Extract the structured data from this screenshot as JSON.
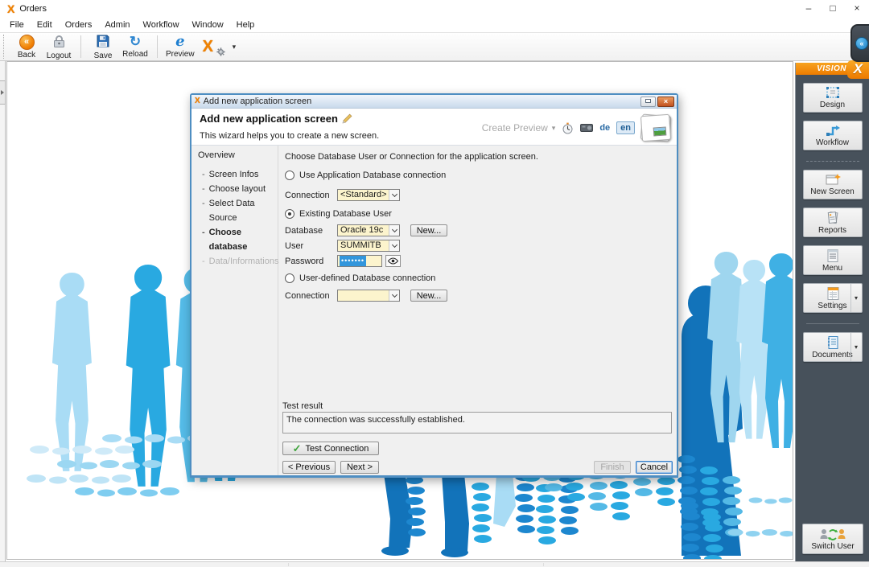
{
  "window": {
    "title": "Orders",
    "controls": {
      "minimize": "–",
      "maximize": "□",
      "close": "×"
    }
  },
  "menu_bar": {
    "items": [
      "File",
      "Edit",
      "Orders",
      "Admin",
      "Workflow",
      "Window",
      "Help"
    ]
  },
  "toolbar": {
    "buttons": [
      {
        "label": "Back"
      },
      {
        "label": "Logout"
      },
      {
        "label": "Save"
      },
      {
        "label": "Reload"
      },
      {
        "label": "Preview"
      }
    ]
  },
  "right_panel": {
    "header": "VISION",
    "buttons": [
      {
        "label": "Design"
      },
      {
        "label": "Workflow"
      },
      {
        "label": "New Screen"
      },
      {
        "label": "Reports"
      },
      {
        "label": "Menu"
      },
      {
        "label": "Settings"
      },
      {
        "label": "Documents"
      }
    ],
    "switch_user": "Switch User"
  },
  "dialog": {
    "title": "Add new application screen",
    "controls": {
      "close": "×"
    },
    "header": {
      "title": "Add new application screen",
      "subtitle": "This wizard helps you to create a new screen.",
      "create_preview": "Create Preview",
      "lang_de": "de",
      "lang_en": "en"
    },
    "sidebar": {
      "heading": "Overview",
      "items": [
        {
          "label": "Screen Infos",
          "state": "normal"
        },
        {
          "label": "Choose layout",
          "state": "normal"
        },
        {
          "label": "Select Data Source",
          "state": "normal"
        },
        {
          "label": "Choose database",
          "state": "active"
        },
        {
          "label": "Data/Informations",
          "state": "disabled"
        }
      ]
    },
    "form": {
      "instruction": "Choose Database User or Connection for the application screen.",
      "radio_app_connection": {
        "label": "Use Application Database connection",
        "checked": false
      },
      "connection_label": "Connection",
      "connection_value": "<Standard>",
      "radio_existing_user": {
        "label": "Existing Database User",
        "checked": true
      },
      "database_label": "Database",
      "database_value": "Oracle 19c",
      "new_button": "New...",
      "user_label": "User",
      "user_value": "SUMMITB",
      "password_label": "Password",
      "password_value": "•••••••",
      "radio_user_defined": {
        "label": "User-defined Database connection",
        "checked": false
      },
      "connection2_label": "Connection",
      "connection2_value": "",
      "new_button2": "New...",
      "test_result_label": "Test result",
      "test_result_text": "The connection was successfully established.",
      "test_connection_button": "Test Connection",
      "previous_button": "< Previous",
      "next_button": "Next >",
      "finish_button": "Finish",
      "cancel_button": "Cancel"
    }
  },
  "icons": {
    "back": "«",
    "reload": "↻",
    "preview_e": "e",
    "x_logo": "X",
    "caret": "▾",
    "check": "✓",
    "collapse": "«"
  },
  "colors": {
    "accent_orange": "#f08200",
    "illustration_blue": "#29a9e1",
    "illustration_dark_blue": "#1273ba",
    "field_yellow": "#fcf4cd",
    "selection_blue": "#3296dc",
    "panel_slate": "#47515b"
  }
}
